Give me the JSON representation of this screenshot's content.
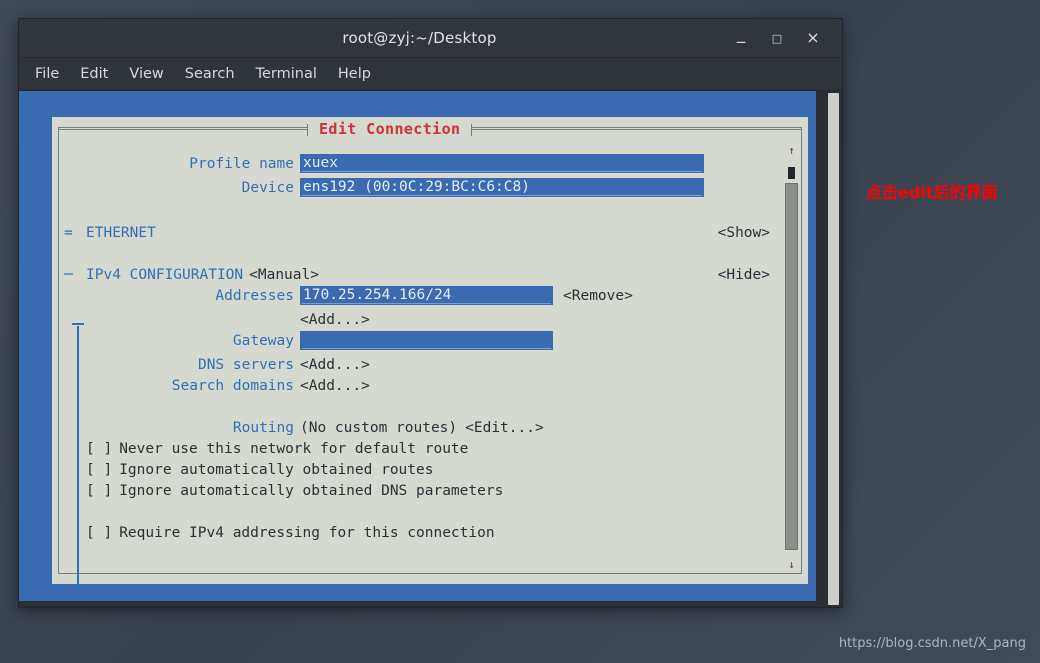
{
  "window": {
    "title": "root@zyj:~/Desktop",
    "controls": {
      "minimize": "_",
      "maximize": "□",
      "close": "×"
    },
    "menu": [
      "File",
      "Edit",
      "View",
      "Search",
      "Terminal",
      "Help"
    ]
  },
  "dialog": {
    "title": "Edit Connection",
    "title_color": "#cc3333",
    "fields": {
      "profile_name_label": "Profile name",
      "profile_name_value": "xuex",
      "device_label": "Device",
      "device_value": "ens192 (00:0C:29:BC:C6:C8)"
    },
    "sections": [
      {
        "marker": "=",
        "name": "ETHERNET",
        "value": "",
        "toggle": "<Show>"
      },
      {
        "marker": "─",
        "name": "IPv4 CONFIGURATION",
        "value": "<Manual>",
        "toggle": "<Hide>"
      }
    ],
    "ipv4": {
      "addresses_label": "Addresses",
      "addresses_value": "170.25.254.166/24",
      "addresses_remove": "<Remove>",
      "addresses_add": "<Add...>",
      "gateway_label": "Gateway",
      "gateway_value": "",
      "dns_label": "DNS servers",
      "dns_add": "<Add...>",
      "search_label": "Search domains",
      "search_add": "<Add...>",
      "routing_label": "Routing",
      "routing_value": "(No custom routes)",
      "routing_edit": "<Edit...>"
    },
    "checkboxes": [
      {
        "box": "[ ]",
        "label": "Never use this network for default route",
        "checked": false
      },
      {
        "box": "[ ]",
        "label": "Ignore automatically obtained routes",
        "checked": false
      },
      {
        "box": "[ ]",
        "label": "Ignore automatically obtained DNS parameters",
        "checked": false
      }
    ],
    "require_checkbox": {
      "box": "[ ]",
      "label": "Require IPv4 addressing for this connection",
      "checked": false
    },
    "scrollbar": {
      "arrow_up": "↑",
      "arrow_down": "↓"
    }
  },
  "annotation": {
    "text": "点击edit后的界面",
    "color": "#ff0000"
  },
  "watermark": {
    "text": "https://blog.csdn.net/X_pang"
  },
  "colors": {
    "terminal_bg": "#3a6ab0",
    "dialog_bg": "#d5d9d0",
    "label_blue": "#2f6fb5",
    "field_blue": "#3a6ab0"
  }
}
